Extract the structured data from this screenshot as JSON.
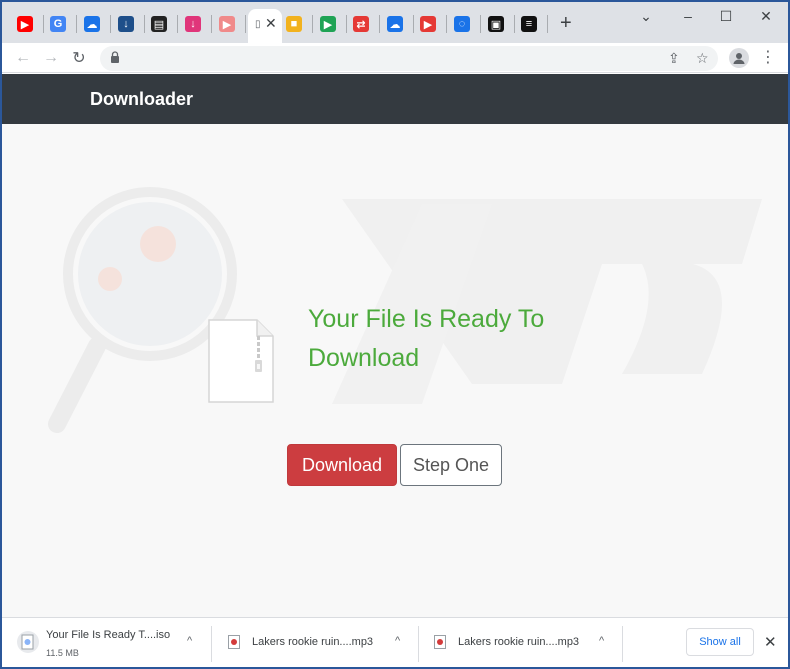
{
  "tabs": {
    "favicons": [
      {
        "name": "youtube-icon",
        "color": "#ff0000",
        "glyph": "▶"
      },
      {
        "name": "google-icon",
        "color": "#4285f4",
        "glyph": "G"
      },
      {
        "name": "cloud-download-icon",
        "color": "#1a73e8",
        "glyph": "☁"
      },
      {
        "name": "download-box-icon",
        "color": "#1e4f8a",
        "glyph": "↓"
      },
      {
        "name": "clapperboard-icon",
        "color": "#222222",
        "glyph": "▤"
      },
      {
        "name": "download-pink-icon",
        "color": "#e0357a",
        "glyph": "↓"
      },
      {
        "name": "video-play-icon",
        "color": "#f08a8a",
        "glyph": "▶"
      }
    ],
    "favicons_right": [
      {
        "name": "camera-folder-icon",
        "color": "#f2b21e",
        "glyph": "■"
      },
      {
        "name": "play-green-icon",
        "color": "#1fa355",
        "glyph": "▶"
      },
      {
        "name": "repeat-red-icon",
        "color": "#e53935",
        "glyph": "⇄"
      },
      {
        "name": "cloud-download-icon",
        "color": "#1a73e8",
        "glyph": "☁"
      },
      {
        "name": "play-red-icon",
        "color": "#e53935",
        "glyph": "▶"
      },
      {
        "name": "loading-spinner-icon",
        "color": "#1a73e8",
        "glyph": "◌"
      },
      {
        "name": "box-app-icon",
        "color": "#111111",
        "glyph": "▣"
      },
      {
        "name": "stripes-icon",
        "color": "#111111",
        "glyph": "≡"
      }
    ],
    "active_close": "✕",
    "new_tab": "+"
  },
  "window_controls": {
    "minimize": "–",
    "maximize": "☐",
    "close": "✕",
    "dropdown": "⌄"
  },
  "toolbar": {
    "back": "←",
    "forward": "→",
    "reload": "↻",
    "share": "⇪",
    "star": "☆",
    "menu": "⋮"
  },
  "site": {
    "brand": "Downloader",
    "ready_title": "Your File Is Ready To Download",
    "download_button": "Download",
    "step_button": "Step One",
    "accent_green": "#4caa3c",
    "accent_red": "#cc3d40"
  },
  "downloads": [
    {
      "name": "Your File Is Ready T....iso",
      "size": "11.5 MB"
    },
    {
      "name": "Lakers rookie ruin....mp3"
    },
    {
      "name": "Lakers rookie ruin....mp3"
    }
  ],
  "shelf": {
    "show_all": "Show all",
    "close": "✕",
    "chevron": "^"
  }
}
